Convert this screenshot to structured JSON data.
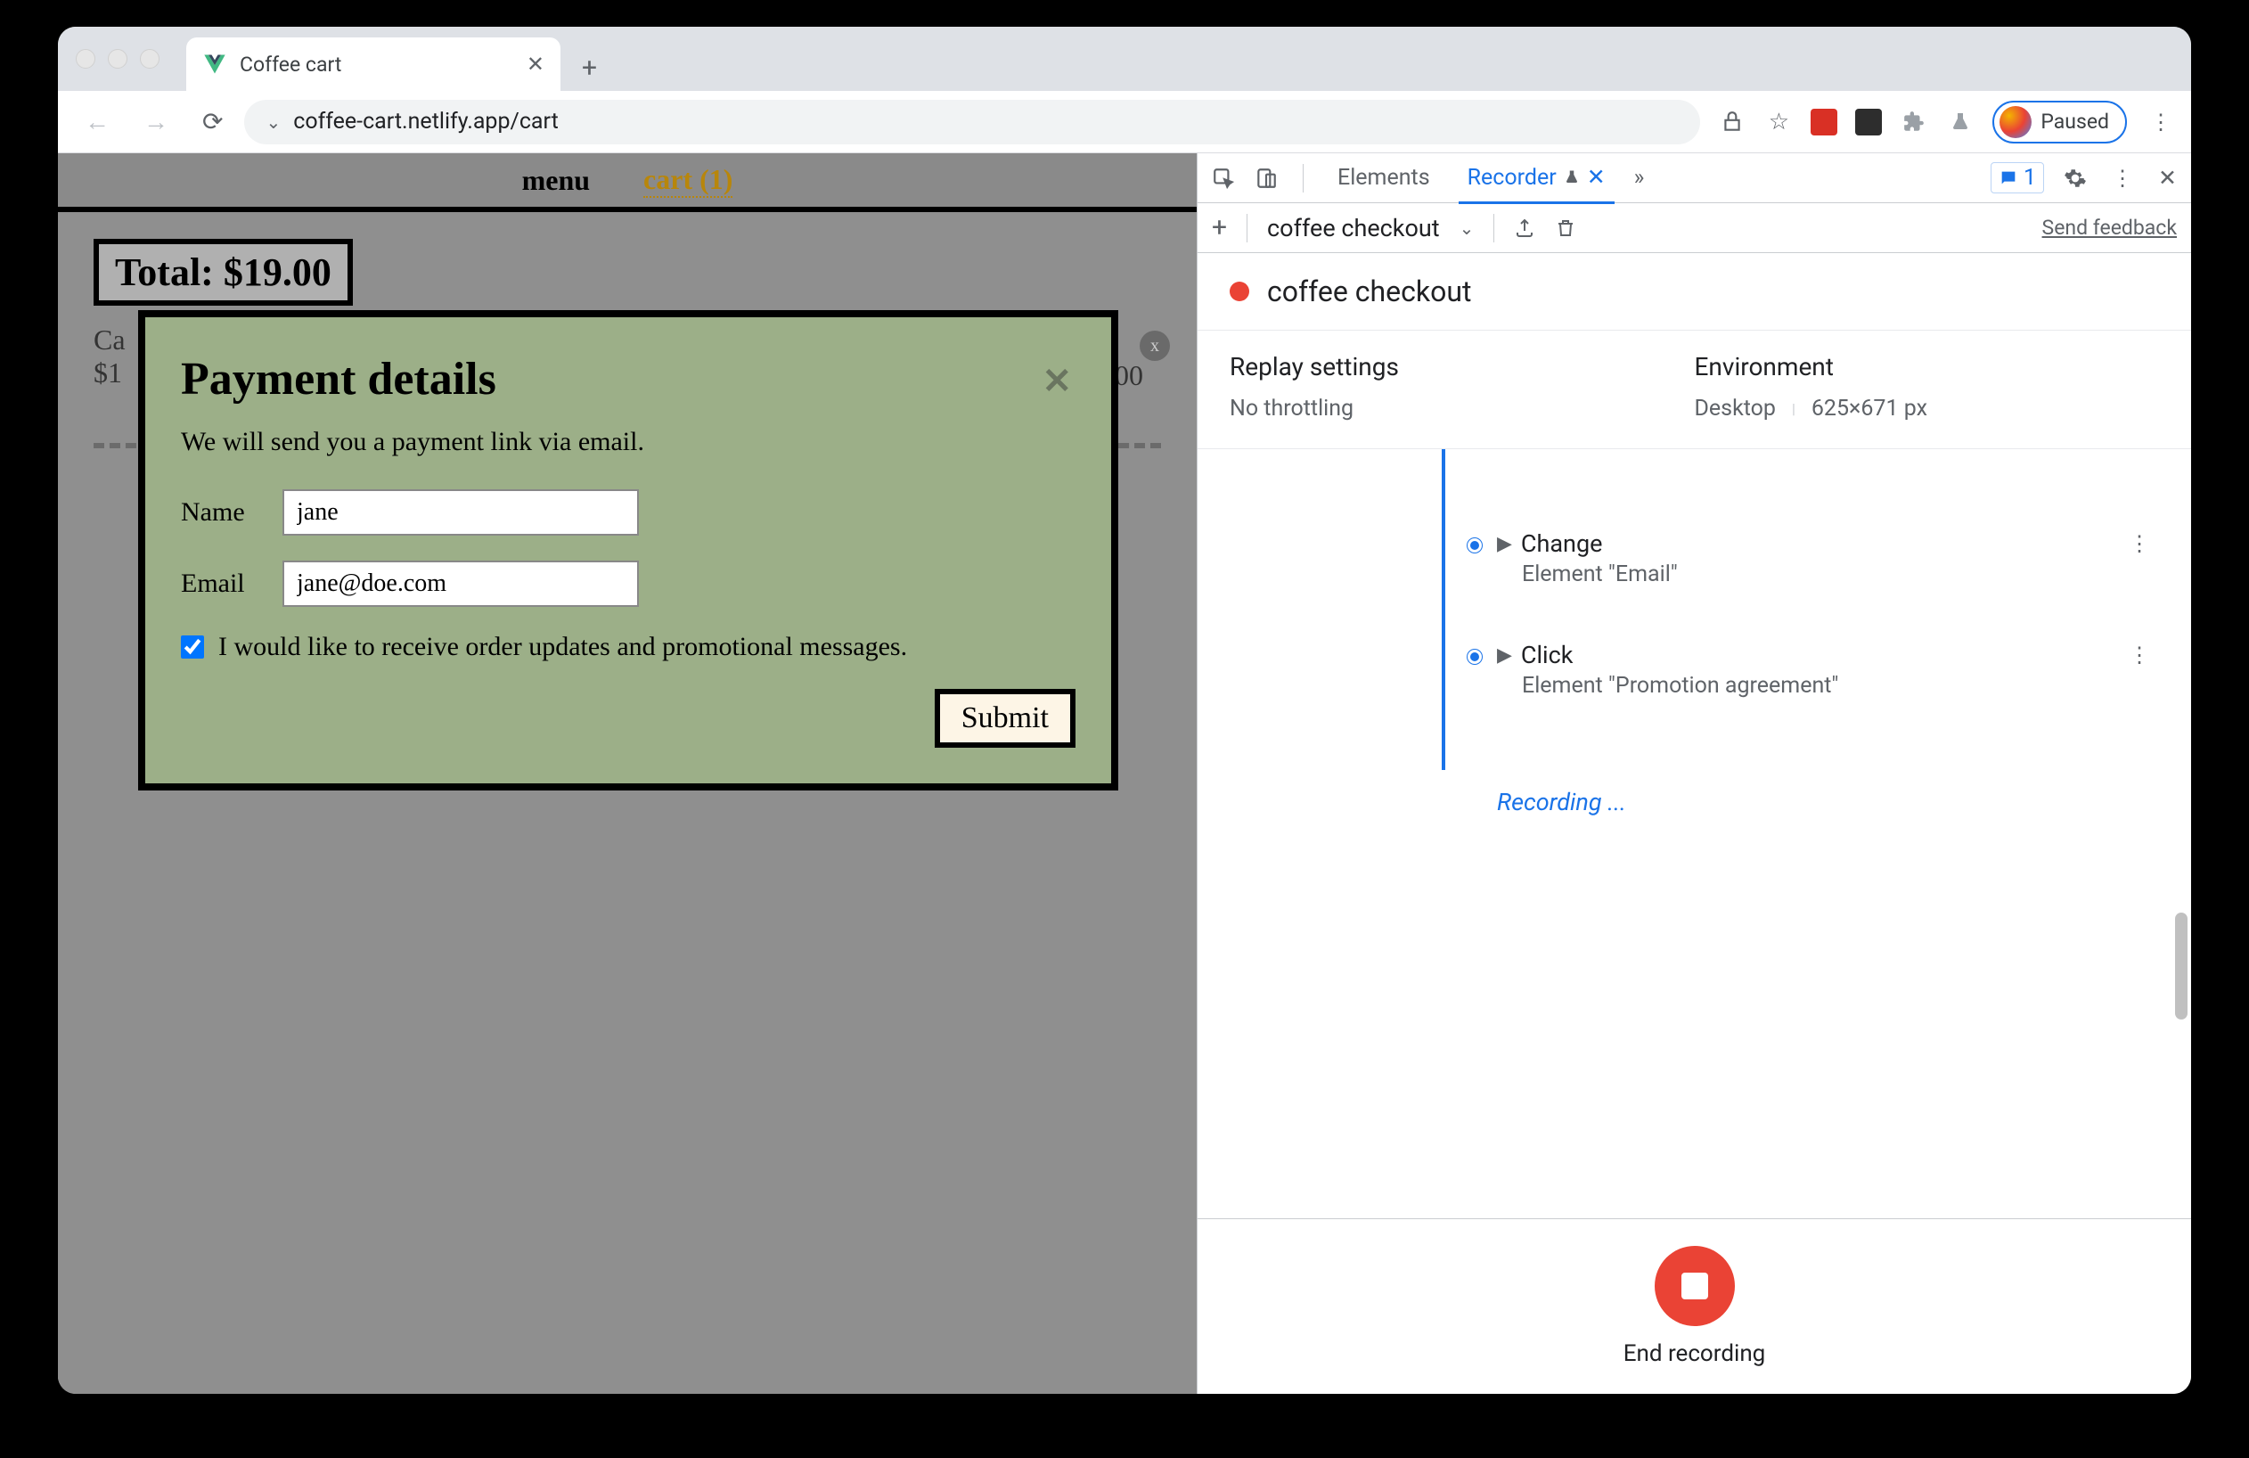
{
  "browser": {
    "tab_title": "Coffee cart",
    "url": "coffee-cart.netlify.app/cart",
    "profile_status": "Paused"
  },
  "page": {
    "nav": {
      "menu": "menu",
      "cart": "cart (1)"
    },
    "total_label": "Total: $19.00",
    "item_name_partial": "Ca",
    "item_price_partial": "$1",
    "item_right_partial": "00"
  },
  "modal": {
    "title": "Payment details",
    "subtitle": "We will send you a payment link via email.",
    "name_label": "Name",
    "name_value": "jane",
    "email_label": "Email",
    "email_value": "jane@doe.com",
    "promo_label": "I would like to receive order updates and promotional messages.",
    "submit": "Submit"
  },
  "devtools": {
    "tabs": {
      "elements": "Elements",
      "recorder": "Recorder"
    },
    "issues_count": "1",
    "toolbar": {
      "recording_name": "coffee checkout",
      "feedback": "Send feedback"
    },
    "header_title": "coffee checkout",
    "replay_settings": {
      "title": "Replay settings",
      "value": "No throttling"
    },
    "environment": {
      "title": "Environment",
      "device": "Desktop",
      "viewport": "625×671 px"
    },
    "steps": [
      {
        "action": "Change",
        "detail": "Element \"Email\""
      },
      {
        "action": "Click",
        "detail": "Element \"Promotion agreement\""
      }
    ],
    "recording_label": "Recording ...",
    "end_recording": "End recording"
  }
}
